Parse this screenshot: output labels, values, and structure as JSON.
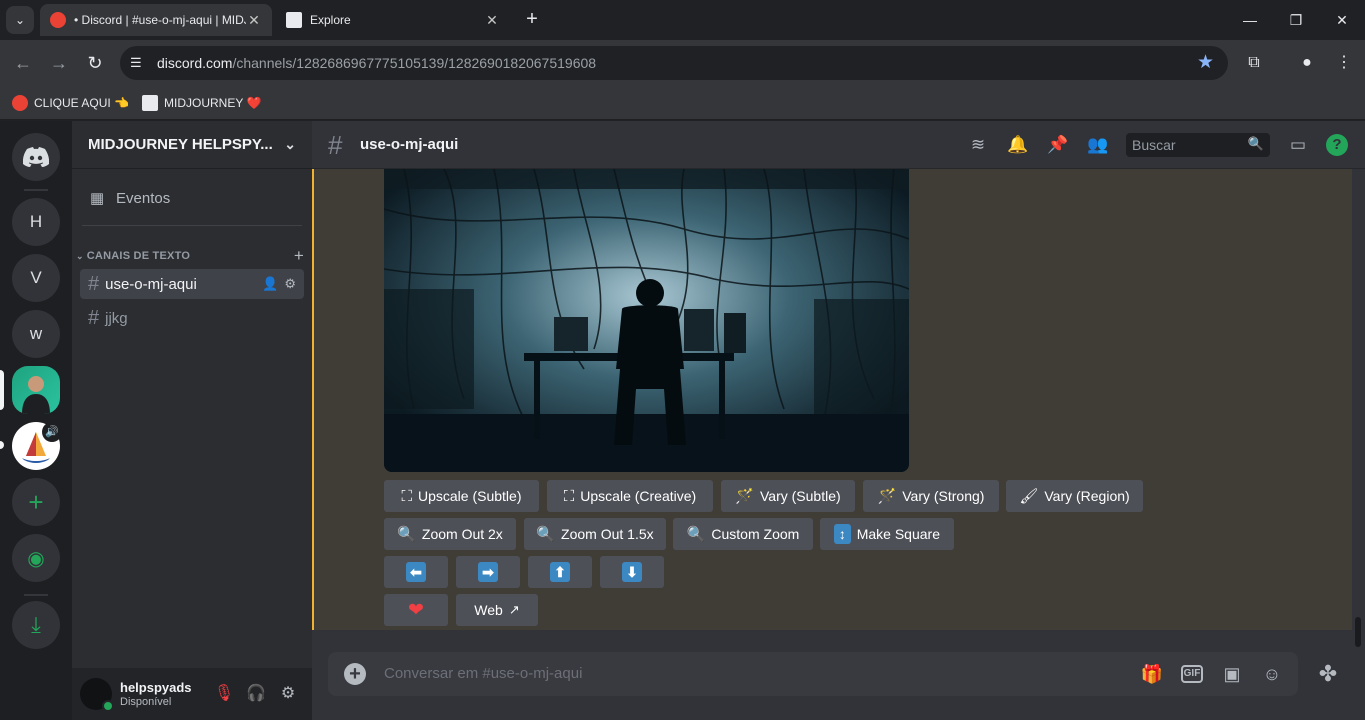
{
  "browser": {
    "tabs": [
      {
        "title": "• Discord | #use-o-mj-aqui | MIDJOURNEY",
        "active": true
      },
      {
        "title": "Explore",
        "active": false
      }
    ],
    "url_domain": "discord.com",
    "url_path": "/channels/1282686967775105139/1282690182067519608",
    "bookmarks": [
      {
        "label": "CLIQUE AQUI 👈"
      },
      {
        "label": "MIDJOURNEY ❤️"
      }
    ]
  },
  "guilds": {
    "items": [
      {
        "label": "H"
      },
      {
        "label": "V"
      },
      {
        "label": "w"
      }
    ]
  },
  "sidebar": {
    "server_name": "MIDJOURNEY HELPSPY...",
    "events_label": "Eventos",
    "category_label": "CANAIS DE TEXTO",
    "channels": [
      {
        "name": "use-o-mj-aqui",
        "active": true
      },
      {
        "name": "jjkg",
        "active": false
      }
    ]
  },
  "user": {
    "name": "helpspyads",
    "status": "Disponível"
  },
  "channel_header": {
    "name": "use-o-mj-aqui",
    "search_placeholder": "Buscar"
  },
  "buttons": {
    "row1": [
      {
        "emoji": "⛶",
        "label": "Upscale (Subtle)"
      },
      {
        "emoji": "⛶",
        "label": "Upscale (Creative)"
      },
      {
        "emoji": "🪄",
        "label": "Vary (Subtle)"
      },
      {
        "emoji": "🪄",
        "label": "Vary (Strong)"
      },
      {
        "emoji": "🖌",
        "label": "Vary (Region)"
      }
    ],
    "row2": [
      {
        "emoji": "🔍",
        "label": "Zoom Out 2x"
      },
      {
        "emoji": "🔍",
        "label": "Zoom Out 1.5x"
      },
      {
        "emoji": "🔍",
        "label": "Custom Zoom"
      },
      {
        "emoji": "↕",
        "label": "Make Square"
      }
    ],
    "arrows": [
      "⬅",
      "➡",
      "⬆",
      "⬇"
    ],
    "heart": "❤",
    "web_label": "Web"
  },
  "composer": {
    "placeholder": "Conversar em #use-o-mj-aqui"
  },
  "colors": {
    "accent": "#5865f2",
    "online": "#23a55a",
    "mention_bar": "#f0b232",
    "button_bg": "#4e5058"
  }
}
